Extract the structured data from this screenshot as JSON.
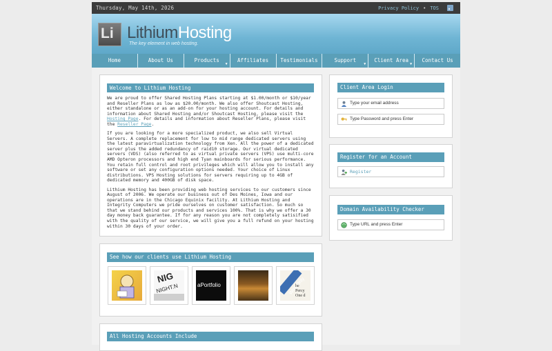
{
  "topbar": {
    "date": "Thursday, May 14th, 2026",
    "privacy": "Privacy Policy",
    "separator": "•",
    "tos": "TOS"
  },
  "header": {
    "logo_mark": "Li",
    "logo_part1": "Lithium",
    "logo_part2": "Hosting",
    "tagline": "The key element in web hosting."
  },
  "nav": [
    {
      "label": "Home"
    },
    {
      "label": "About Us"
    },
    {
      "label": "Products"
    },
    {
      "label": "Affiliates"
    },
    {
      "label": "Testimonials"
    },
    {
      "label": "Support"
    },
    {
      "label": "Client Area"
    },
    {
      "label": "Contact Us"
    }
  ],
  "welcome": {
    "title": "Welcome to Lithium Hosting",
    "p1_a": "We are proud to offer Shared Hosting Plans starting at $1.00/month or $10/year and Reseller Plans as low as $20.00/month. We also offer Shoutcast Hosting, either standalone or as an add-on for your hosting account. For details and information about Shared Hosting and/or Shoutcast Hosting, please visit the ",
    "p1_link1": "Hosting Page",
    "p1_b": ". For details and information about Reseller Plans, please visit the ",
    "p1_link2": "Reseller Page",
    "p1_c": ".",
    "p2": "If you are looking for a more specialized product, we also sell Virtual Servers. A complete replacement for low to mid range dedicated servers using the latest paravirtualization technology from Xen. All the power of a dedicated server plus the added redundancy of raid10 storage. Our virtual dedicated servers (VDS) (also referred to as virtual private servers (VPS) use multi-core AMD Opteron processors and high end Tyan mainboards for serious performance. You retain full control and root privileges which will allow you to install any software or set any configuration options needed. Your choice of Linux distributions. VPS Hosting solutions for servers requiring up to 4GB of dedicated memory and 400GB of disk space.",
    "p3": "Lithium Hosting has been providing web hosting services to our customers since August of 2006. We operate our business out of Des Moines, Iowa and our operations are in the Chicago Equinix facility. At Lithium Hosting and Integrity Computers we pride ourselves on customer satisfaction. So much so that we stand behind our products and services 100%. That is why we offer a 30 day money back guarantee. If for any reason you are not completely satisified with the quality of our service, we will give you a full refund on your hosting within 30 days of your order."
  },
  "clients": {
    "title": "See how our clients use Lithium Hosting",
    "thumbs": [
      {
        "name": "cartoon",
        "text": ""
      },
      {
        "name": "night",
        "text": "NIGHT.N"
      },
      {
        "name": "aportfolio",
        "text": "aPortfolio"
      },
      {
        "name": "painting",
        "text": ""
      },
      {
        "name": "writeonly",
        "text": "WriteOnly"
      }
    ]
  },
  "accounts": {
    "title": "All Hosting Accounts Include"
  },
  "login": {
    "title": "Client Area Login",
    "email_placeholder": "Type your email address",
    "password_placeholder": "Type Password and press Enter"
  },
  "register": {
    "title": "Register for an Account",
    "link": "Register"
  },
  "domain": {
    "title": "Domain Availability Checker",
    "placeholder": "Type URL and press Enter"
  }
}
